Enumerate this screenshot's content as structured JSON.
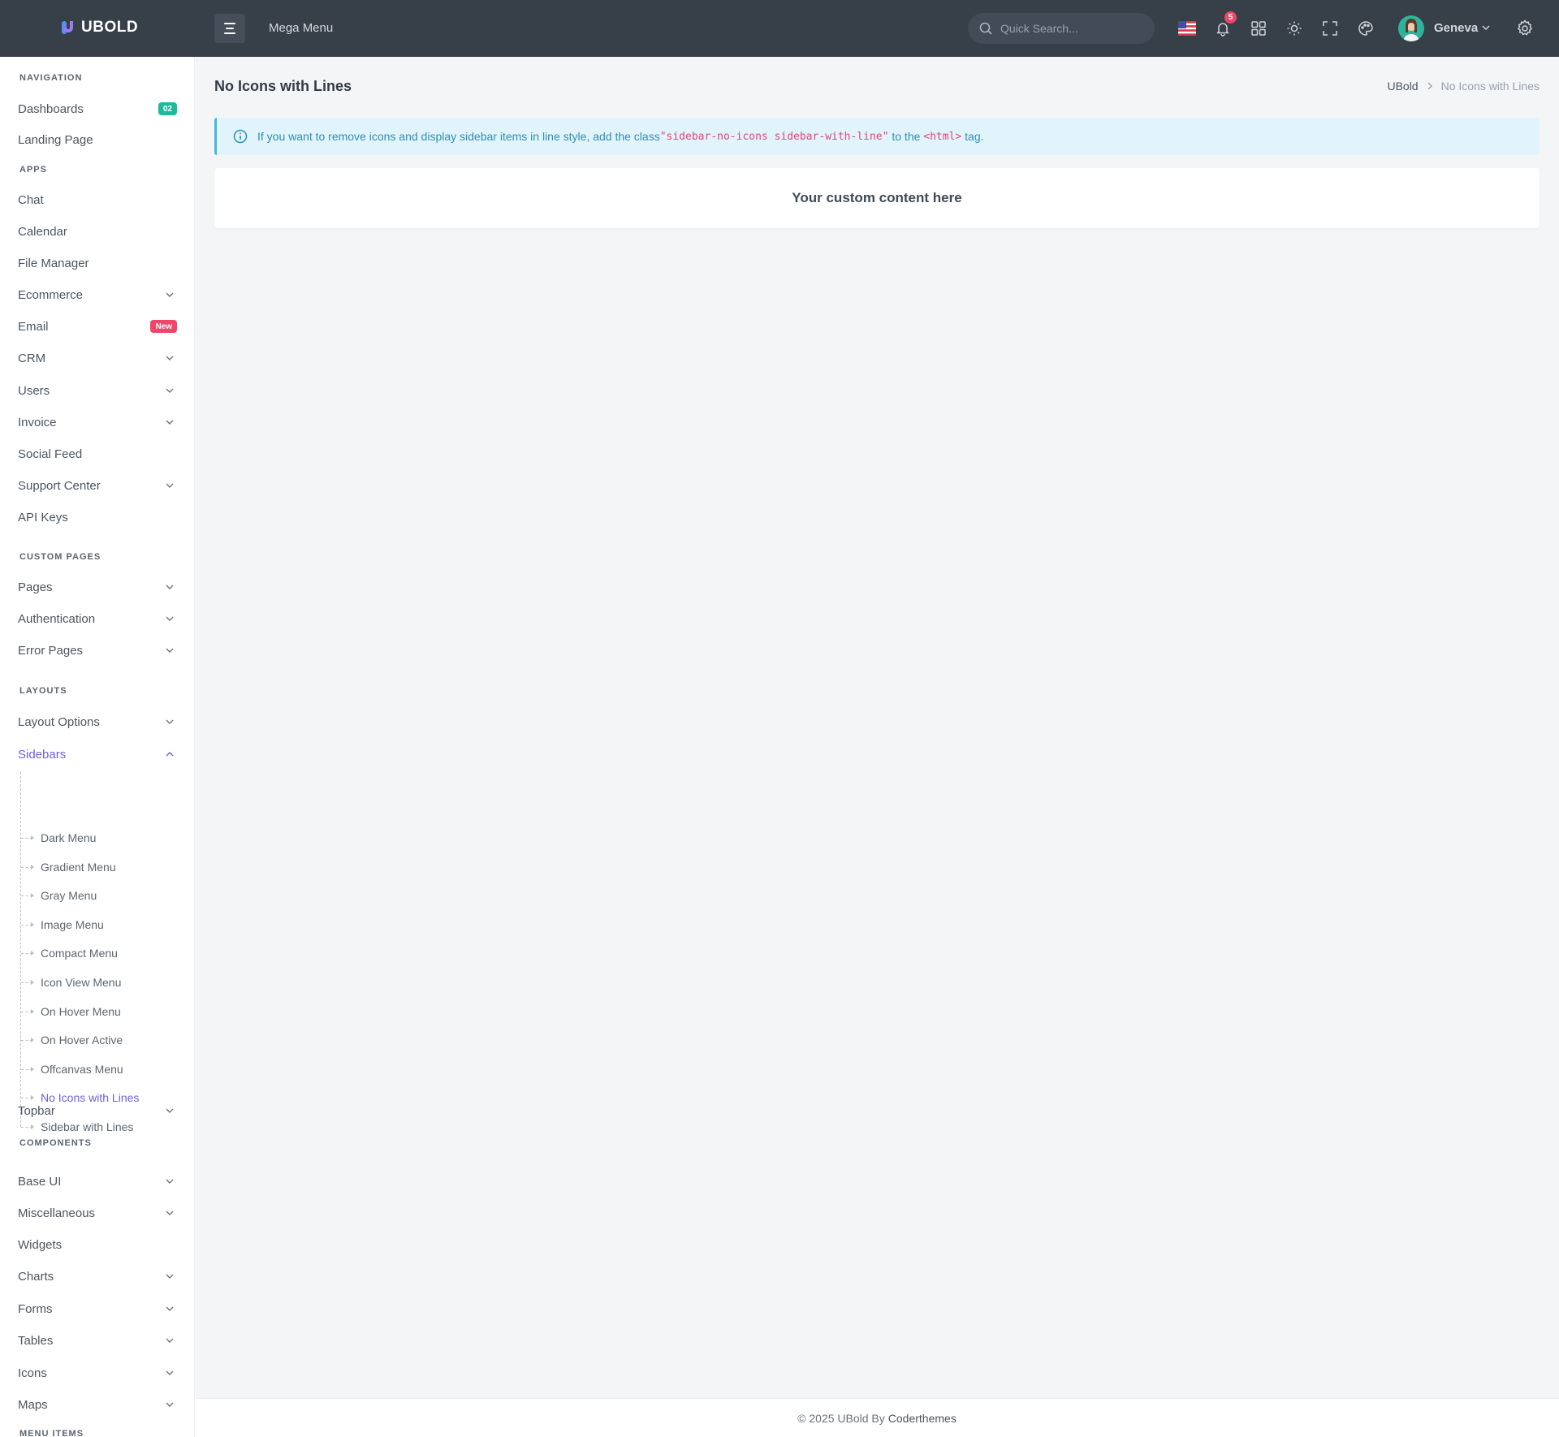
{
  "header": {
    "logo_text": "UBOLD",
    "mega_menu": "Mega Menu",
    "search_placeholder": "Quick Search...",
    "notification_count": "5",
    "user_name": "Geneva"
  },
  "sidebar": {
    "sections": {
      "navigation": "NAVIGATION",
      "apps": "APPS",
      "custom_pages": "CUSTOM PAGES",
      "layouts": "LAYOUTS",
      "components": "COMPONENTS",
      "menu_items": "MENU ITEMS"
    },
    "items": {
      "dashboards": "Dashboards",
      "dashboards_badge": "02",
      "landing": "Landing Page",
      "chat": "Chat",
      "calendar": "Calendar",
      "file_manager": "File Manager",
      "ecommerce": "Ecommerce",
      "email": "Email",
      "email_badge": "New",
      "crm": "CRM",
      "users": "Users",
      "invoice": "Invoice",
      "social_feed": "Social Feed",
      "support_center": "Support Center",
      "api_keys": "API Keys",
      "pages": "Pages",
      "authentication": "Authentication",
      "error_pages": "Error Pages",
      "layout_options": "Layout Options",
      "sidebars": "Sidebars",
      "topbar": "Topbar",
      "base_ui": "Base UI",
      "miscellaneous": "Miscellaneous",
      "widgets": "Widgets",
      "charts": "Charts",
      "forms": "Forms",
      "tables": "Tables",
      "icons": "Icons",
      "maps": "Maps"
    },
    "sidebars_sub": [
      "Dark Menu",
      "Gradient Menu",
      "Gray Menu",
      "Image Menu",
      "Compact Menu",
      "Icon View Menu",
      "On Hover Menu",
      "On Hover Active",
      "Offcanvas Menu",
      "No Icons with Lines",
      "Sidebar with Lines"
    ]
  },
  "main": {
    "page_title": "No Icons with Lines",
    "breadcrumb_root": "UBold",
    "breadcrumb_current": "No Icons with Lines",
    "alert_pre": "If you want to remove icons and display sidebar items in line style, add the class ",
    "alert_code1": "\"sidebar-no-icons sidebar-with-line\"",
    "alert_mid": " to the ",
    "alert_code2": "<html>",
    "alert_post": " tag.",
    "card_text": "Your custom content here"
  },
  "footer": {
    "text": "© 2025 UBold By",
    "brand": "Coderthemes"
  },
  "colors": {
    "topbar": "#373f49",
    "accent": "#6f5fdd",
    "badge_green": "#1abc9c",
    "badge_red": "#f0466a",
    "alert_bg": "#e1f4fb"
  }
}
